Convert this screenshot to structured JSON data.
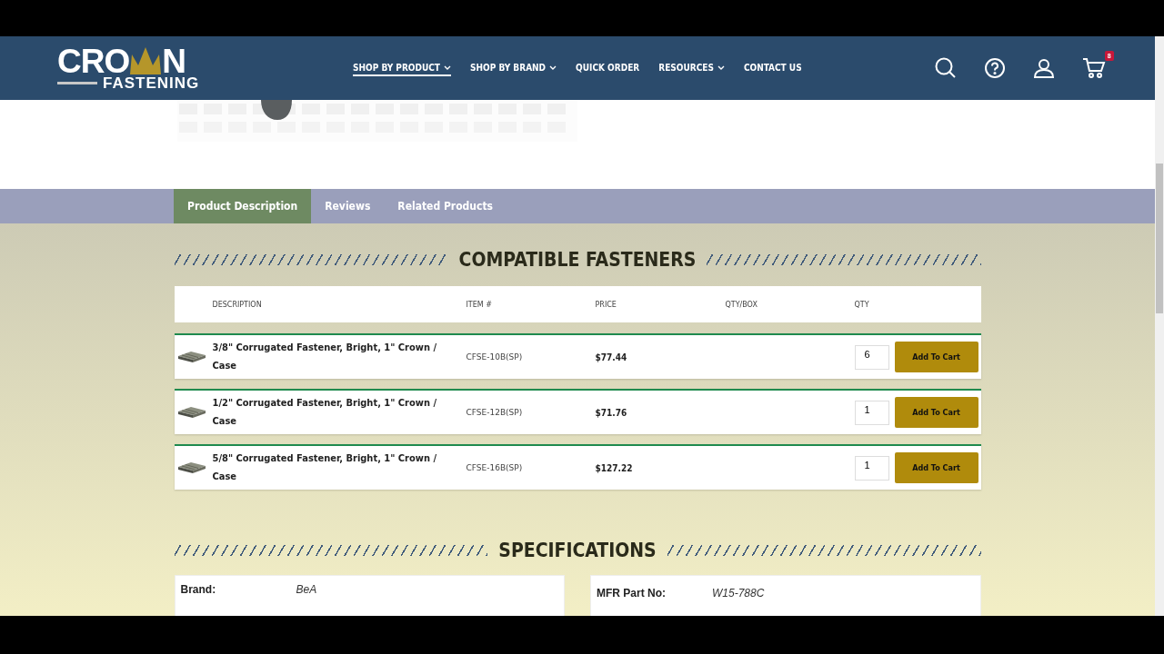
{
  "header": {
    "logo": {
      "top_left": "CRO",
      "top_right": "N",
      "bottom": "FASTENING"
    },
    "nav": [
      {
        "label": "SHOP BY PRODUCT",
        "has_menu": true,
        "selected": true
      },
      {
        "label": "SHOP BY BRAND",
        "has_menu": true,
        "selected": false
      },
      {
        "label": "QUICK ORDER",
        "has_menu": false,
        "selected": false
      },
      {
        "label": "RESOURCES",
        "has_menu": true,
        "selected": false
      },
      {
        "label": "CONTACT US",
        "has_menu": false,
        "selected": false
      }
    ],
    "cart_count": "8"
  },
  "tabs": [
    {
      "label": "Product Description",
      "selected": true
    },
    {
      "label": "Reviews",
      "selected": false
    },
    {
      "label": "Related Products",
      "selected": false
    }
  ],
  "compatible": {
    "title": "COMPATIBLE FASTENERS",
    "columns": [
      "DESCRIPTION",
      "ITEM #",
      "PRICE",
      "QTY/BOX",
      "QTY"
    ],
    "rows": [
      {
        "description": "3/8\" Corrugated Fastener, Bright, 1\" Crown / Case",
        "item": "CFSE-10B(SP)",
        "price": "$77.44",
        "qty": "6",
        "button": "Add To Cart"
      },
      {
        "description": "1/2\" Corrugated Fastener, Bright, 1\" Crown / Case",
        "item": "CFSE-12B(SP)",
        "price": "$71.76",
        "qty": "1",
        "button": "Add To Cart"
      },
      {
        "description": "5/8\" Corrugated Fastener, Bright, 1\" Crown / Case",
        "item": "CFSE-16B(SP)",
        "price": "$127.22",
        "qty": "1",
        "button": "Add To Cart"
      }
    ]
  },
  "specifications": {
    "title": "SPECIFICATIONS",
    "items": [
      {
        "label": "Brand:",
        "value": "BeA"
      },
      {
        "label": "MFR Part No:",
        "value": "W15-788C"
      }
    ]
  }
}
